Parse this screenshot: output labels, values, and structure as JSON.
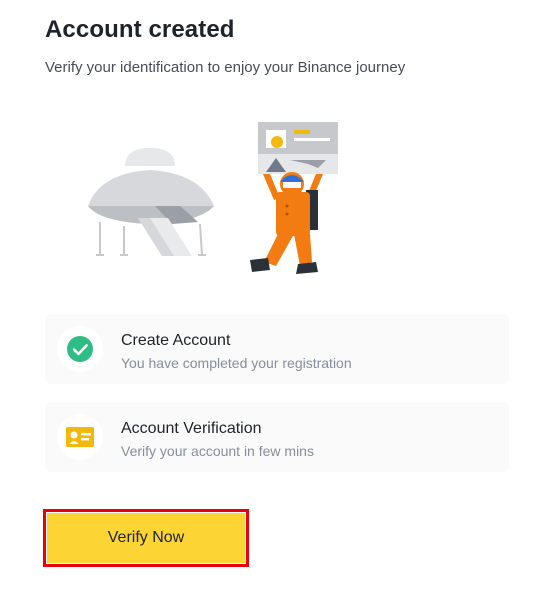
{
  "header": {
    "title": "Account created",
    "subtitle": "Verify your identification to enjoy your Binance journey"
  },
  "illustration": {
    "icon": "ufo-astronaut-illustration"
  },
  "steps": [
    {
      "title": "Create Account",
      "description": "You have completed your registration",
      "icon": "check-circle-icon",
      "status": "completed"
    },
    {
      "title": "Account Verification",
      "description": "Verify your account in few mins",
      "icon": "id-card-icon",
      "status": "pending"
    }
  ],
  "actions": {
    "verify_label": "Verify Now"
  },
  "colors": {
    "brand_yellow": "#fcd535",
    "success_green": "#2ebd85",
    "text_primary": "#1e2329",
    "text_secondary": "#848e9c",
    "highlight_red": "#e8000b"
  }
}
